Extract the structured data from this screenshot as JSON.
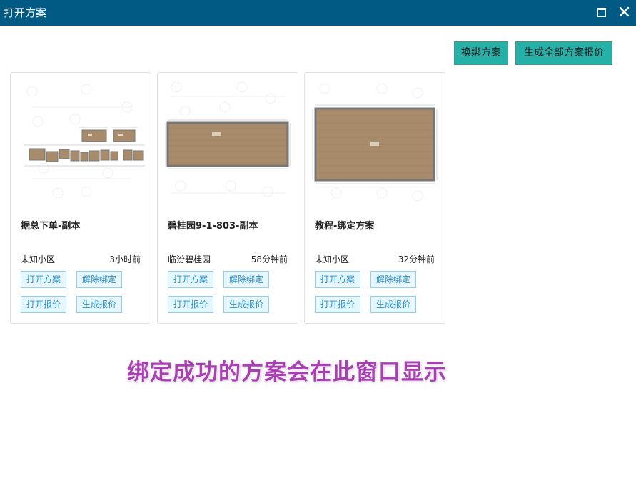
{
  "window": {
    "title": "打开方案",
    "maximize_icon": "maximize-icon",
    "close_icon": "close-icon",
    "titlebar_color": "#005a84"
  },
  "toolbar": {
    "rebind_label": "换绑方案",
    "generate_all_label": "生成全部方案报价",
    "button_color": "#25b0a8"
  },
  "cards": [
    {
      "name": "据总下单-副本",
      "community": "未知小区",
      "time": "3小时前",
      "thumbnail_icon": "floor-plan-thumbnail",
      "open_label": "打开方案",
      "unbind_label": "解除绑定",
      "open_quote_label": "打开报价",
      "gen_quote_label": "生成报价"
    },
    {
      "name": "碧桂园9-1-803-副本",
      "community": "临汾碧桂园",
      "time": "58分钟前",
      "thumbnail_icon": "floor-plan-thumbnail",
      "open_label": "打开方案",
      "unbind_label": "解除绑定",
      "open_quote_label": "打开报价",
      "gen_quote_label": "生成报价"
    },
    {
      "name": "教程-绑定方案",
      "community": "未知小区",
      "time": "32分钟前",
      "thumbnail_icon": "floor-plan-thumbnail",
      "open_label": "打开方案",
      "unbind_label": "解除绑定",
      "open_quote_label": "打开报价",
      "gen_quote_label": "生成报价"
    }
  ],
  "caption": {
    "text": "绑定成功的方案会在此窗口显示",
    "color": "#a83fb3"
  },
  "colors": {
    "card_button_bg": "#e6f6fd",
    "card_button_text": "#2a8ec4",
    "floor_wood": "#a78b6a"
  }
}
